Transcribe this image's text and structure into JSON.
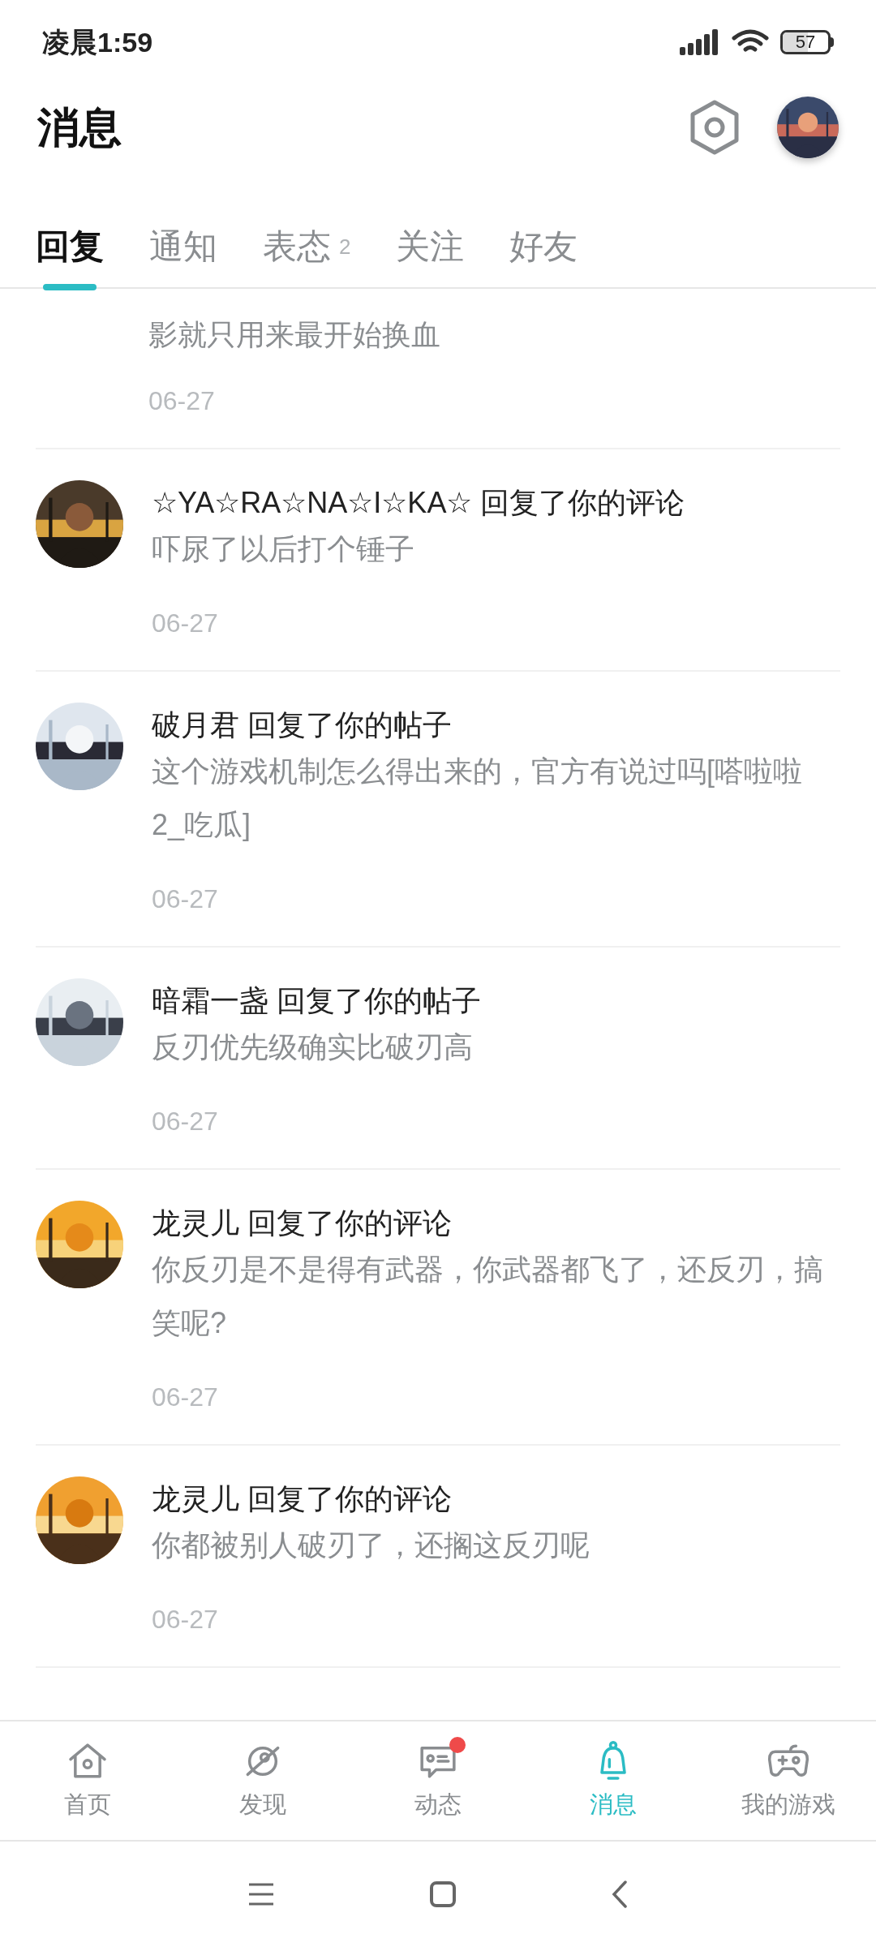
{
  "status_bar": {
    "time": "凌晨1:59",
    "battery": "57"
  },
  "header": {
    "title": "消息"
  },
  "tabs": [
    {
      "label": "回复",
      "selected": true
    },
    {
      "label": "通知",
      "selected": false
    },
    {
      "label": "表态",
      "selected": false,
      "count": "2"
    },
    {
      "label": "关注",
      "selected": false
    },
    {
      "label": "好友",
      "selected": false
    }
  ],
  "messages": [
    {
      "partial": true,
      "text": "影就只用来最开始换血",
      "date": "06-27"
    },
    {
      "title": "☆YA☆RA☆NA☆I☆KA☆ 回复了你的评论",
      "text": "吓尿了以后打个锤子",
      "date": "06-27"
    },
    {
      "title": "破月君 回复了你的帖子",
      "text": "这个游戏机制怎么得出来的，官方有说过吗[嗒啦啦2_吃瓜]",
      "date": "06-27"
    },
    {
      "title": "暗霜一盏 回复了你的帖子",
      "text": "反刃优先级确实比破刃高",
      "date": "06-27"
    },
    {
      "title": "龙灵儿 回复了你的评论",
      "text": "你反刃是不是得有武器，你武器都飞了，还反刃，搞笑呢?",
      "date": "06-27"
    },
    {
      "title": "龙灵儿 回复了你的评论",
      "text": "你都被别人破刃了，还搁这反刃呢",
      "date": "06-27"
    }
  ],
  "bottom_nav": [
    {
      "label": "首页",
      "selected": false,
      "kind": "home",
      "badge": false
    },
    {
      "label": "发现",
      "selected": false,
      "kind": "discover",
      "badge": false
    },
    {
      "label": "动态",
      "selected": false,
      "kind": "feed",
      "badge": true
    },
    {
      "label": "消息",
      "selected": true,
      "kind": "bell",
      "badge": false
    },
    {
      "label": "我的游戏",
      "selected": false,
      "kind": "games",
      "badge": false
    }
  ]
}
